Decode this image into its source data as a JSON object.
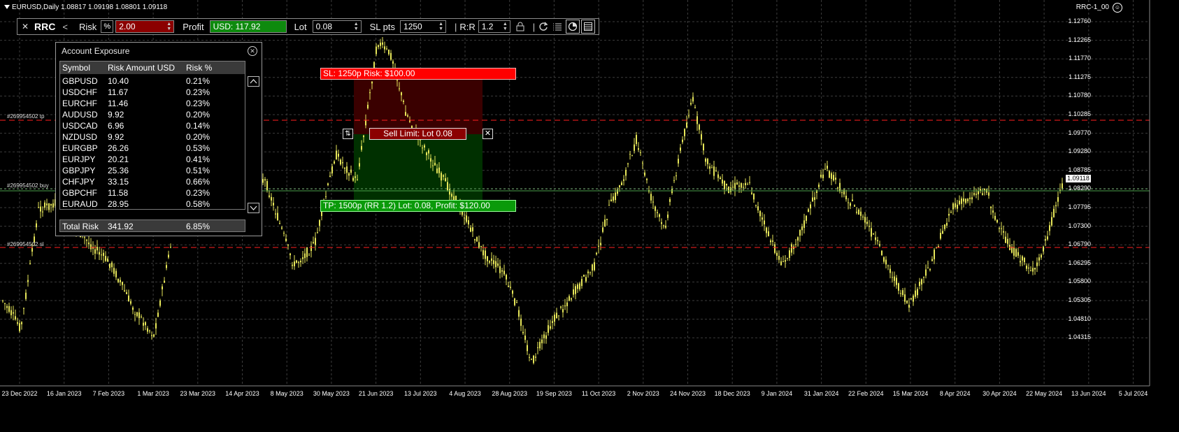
{
  "chart": {
    "title": "EURUSD,Daily  1.08817 1.09198 1.08801 1.09118",
    "ea_label": "RRC-1_00",
    "colors": {
      "candle": "#e6e65a",
      "grid": "#3c3c3c",
      "sl_line": "#ff2020",
      "tp_line": "#ff2020",
      "bid": "#6aa56a"
    },
    "price_axis": [
      "1.12760",
      "1.12265",
      "1.11770",
      "1.11275",
      "1.10780",
      "1.10285",
      "1.09770",
      "1.09280",
      "1.08785",
      "1.08290",
      "1.07795",
      "1.07300",
      "1.06790",
      "1.06295",
      "1.05800",
      "1.05305",
      "1.04810",
      "1.04315"
    ],
    "current_price": "1.09118",
    "date_axis": [
      "23 Dec 2022",
      "16 Jan 2023",
      "7 Feb 2023",
      "1 Mar 2023",
      "23 Mar 2023",
      "14 Apr 2023",
      "8 May 2023",
      "30 May 2023",
      "21 Jun 2023",
      "13 Jul 2023",
      "4 Aug 2023",
      "28 Aug 2023",
      "19 Sep 2023",
      "11 Oct 2023",
      "2 Nov 2023",
      "24 Nov 2023",
      "18 Dec 2023",
      "9 Jan 2024",
      "31 Jan 2024",
      "22 Feb 2024",
      "15 Mar 2024",
      "8 Apr 2024",
      "30 Apr 2024",
      "22 May 2024",
      "13 Jun 2024",
      "5 Jul 2024"
    ],
    "order_labels": {
      "tp": "#269954502 tp",
      "buy": "#269954502 buy",
      "sl": "#269954502 sl"
    }
  },
  "toolbar": {
    "close": "✕",
    "name": "RRC",
    "collapse": "<",
    "risk_label": "Risk",
    "risk_unit": "%",
    "risk_value": "2.00",
    "profit_label": "Profit",
    "profit_value": "USD: 117.92",
    "lot_label": "Lot",
    "lot_value": "0.08",
    "sl_label": "SL pts",
    "sl_value": "1250",
    "sep": "|",
    "rr_label": "R:R",
    "rr_value": "1.2"
  },
  "exposure": {
    "title": "Account Exposure",
    "columns": [
      "Symbol",
      "Risk Amount USD",
      "Risk %"
    ],
    "rows": [
      [
        "GBPUSD",
        "10.40",
        "0.21%"
      ],
      [
        "USDCHF",
        "11.67",
        "0.23%"
      ],
      [
        "EURCHF",
        "11.46",
        "0.23%"
      ],
      [
        "AUDUSD",
        "9.92",
        "0.20%"
      ],
      [
        "USDCAD",
        "6.96",
        "0.14%"
      ],
      [
        "NZDUSD",
        "9.92",
        "0.20%"
      ],
      [
        "EURGBP",
        "26.26",
        "0.53%"
      ],
      [
        "EURJPY",
        "20.21",
        "0.41%"
      ],
      [
        "GBPJPY",
        "25.36",
        "0.51%"
      ],
      [
        "CHFJPY",
        "33.15",
        "0.66%"
      ],
      [
        "GBPCHF",
        "11.58",
        "0.23%"
      ],
      [
        "EURAUD",
        "28.95",
        "0.58%"
      ]
    ],
    "total": [
      "Total Risk",
      "341.92",
      "6.85%"
    ]
  },
  "trade": {
    "sl_text": "SL: 1250p Risk: $100.00",
    "tp_text": "TP: 1500p (RR 1.2) Lot: 0.08, Profit: $120.00",
    "entry_text": "Sell Limit: Lot 0.08",
    "close": "✕"
  }
}
